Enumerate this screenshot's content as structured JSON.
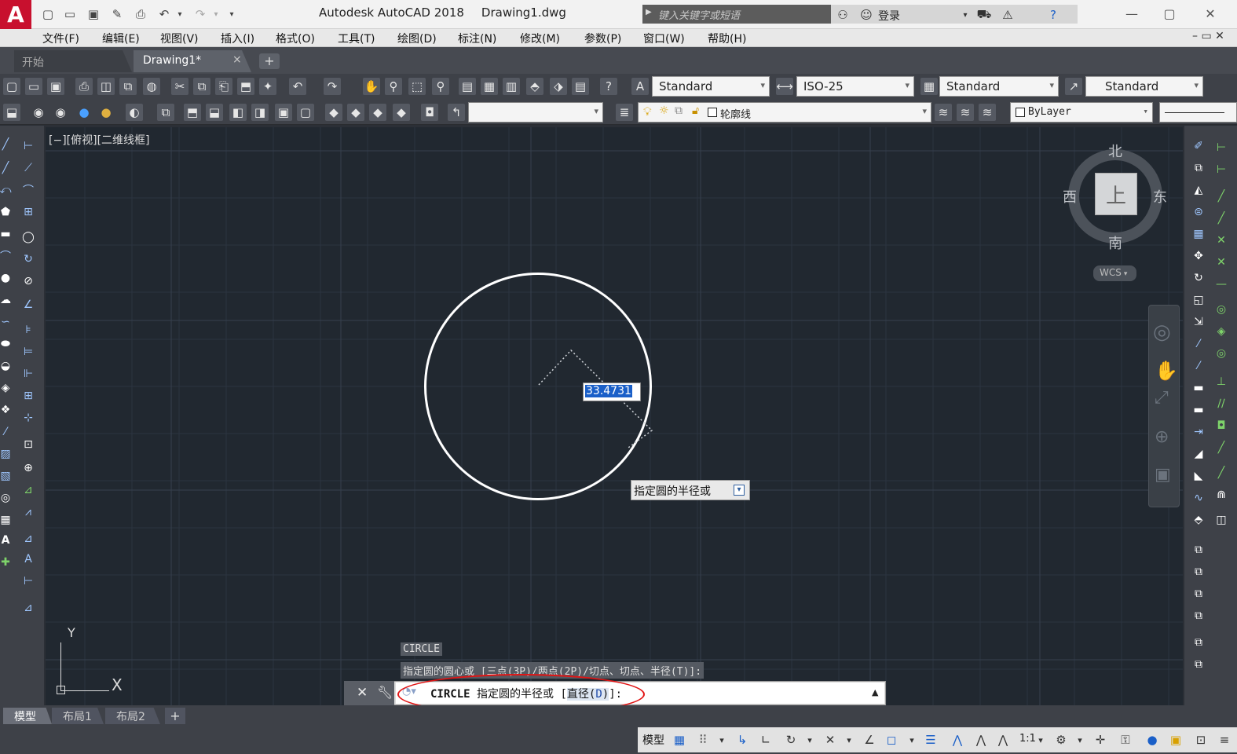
{
  "app": {
    "logo": "A",
    "title": "Autodesk AutoCAD 2018",
    "file": "Drawing1.dwg",
    "search_placeholder": "键入关键字或短语",
    "login": "登录"
  },
  "menu": [
    "文件(F)",
    "编辑(E)",
    "视图(V)",
    "插入(I)",
    "格式(O)",
    "工具(T)",
    "绘图(D)",
    "标注(N)",
    "修改(M)",
    "参数(P)",
    "窗口(W)",
    "帮助(H)"
  ],
  "tabs": {
    "start": "开始",
    "doc": "Drawing1*",
    "new": "+",
    "close": "×"
  },
  "toolbar": {
    "text_style": "Standard",
    "dim_style": "ISO-25",
    "table_style": "Standard",
    "mleader_style": "Standard",
    "layer": "轮廓线",
    "color": "ByLayer"
  },
  "viewport": {
    "label": "[−][俯视][二维线框]"
  },
  "viewcube": {
    "north": "北",
    "south": "南",
    "east": "东",
    "west": "西",
    "face": "上",
    "wcs": "WCS"
  },
  "drawing": {
    "dynamic_input": "33.4731",
    "tooltip": "指定圆的半径或"
  },
  "ucs": {
    "x": "X",
    "y": "Y"
  },
  "command": {
    "history1": "CIRCLE",
    "history2": "指定圆的圆心或 [三点(3P)/两点(2P)/切点、切点、半径(T)]:",
    "name": "CIRCLE",
    "prompt": "指定圆的半径或 [",
    "option": "直径(",
    "option_key": "D",
    "option_end": ")",
    "suffix": "]:"
  },
  "layout_tabs": [
    "模型",
    "布局1",
    "布局2",
    "+"
  ],
  "status": {
    "model": "模型",
    "scale": "1:1"
  },
  "colors": {
    "canvas": "#212830",
    "accent": "#1a5fc8",
    "annotation": "#e21414"
  }
}
